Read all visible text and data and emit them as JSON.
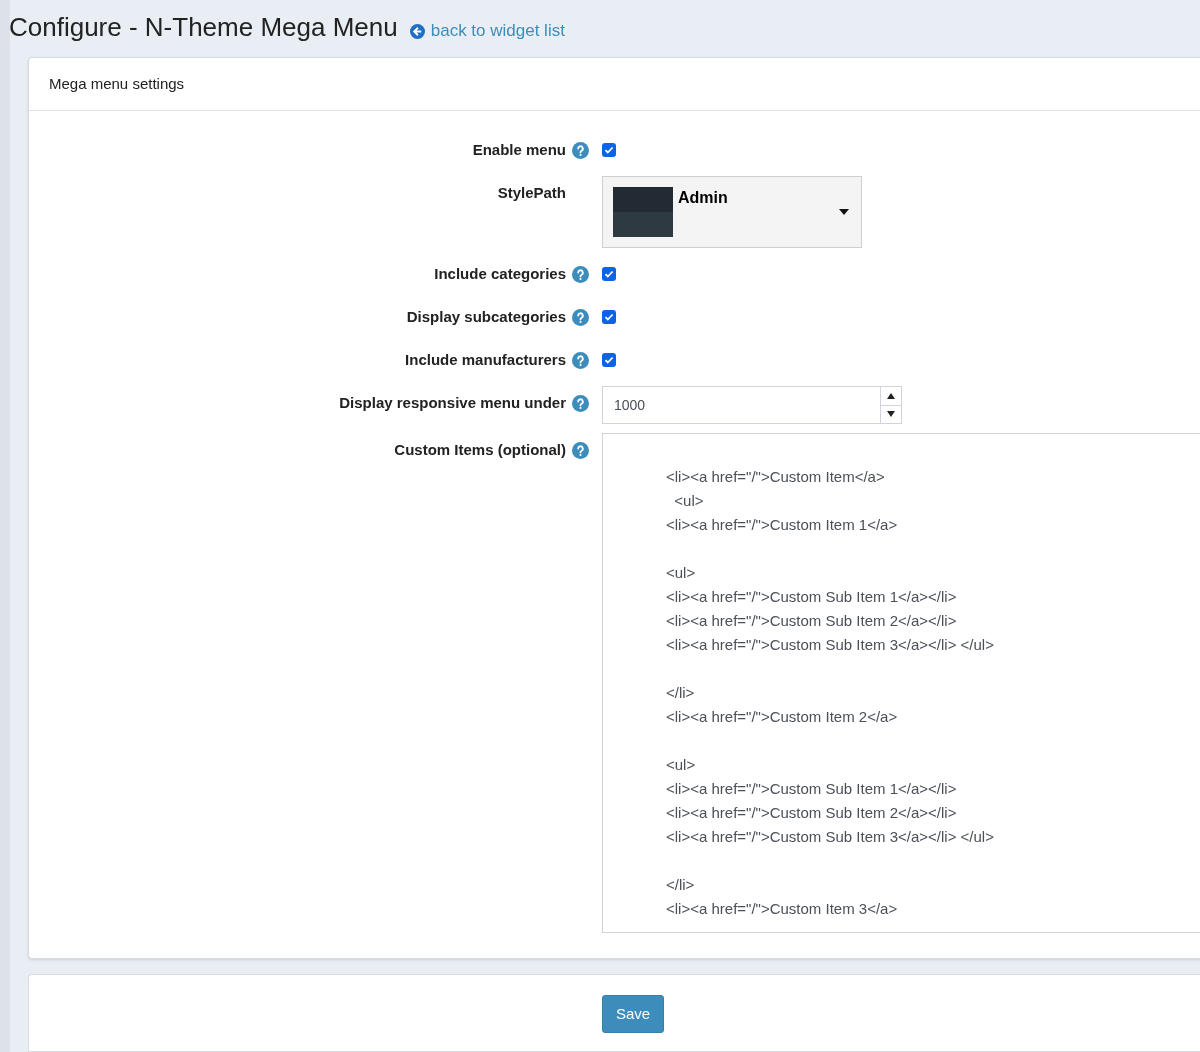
{
  "page": {
    "title": "Configure - N-Theme Mega Menu",
    "back_link": "back to widget list"
  },
  "card": {
    "title": "Mega menu settings"
  },
  "fields": [
    {
      "kind": "checkbox",
      "label": "Enable menu",
      "help": true,
      "checked": true
    },
    {
      "kind": "style-select",
      "label": "StylePath",
      "help": false,
      "value": "Admin"
    },
    {
      "kind": "checkbox",
      "label": "Include categories",
      "help": true,
      "checked": true
    },
    {
      "kind": "checkbox",
      "label": "Display subcategories",
      "help": true,
      "checked": true
    },
    {
      "kind": "checkbox",
      "label": "Include manufacturers",
      "help": true,
      "checked": true
    },
    {
      "kind": "number",
      "label": "Display responsive menu under",
      "help": true,
      "value": "1000"
    },
    {
      "kind": "textarea",
      "label": "Custom Items (optional)",
      "help": true,
      "value": "<li><a href=\"/\">Custom Item</a>\n  <ul>\n<li><a href=\"/\">Custom Item 1</a>\n\n<ul>\n<li><a href=\"/\">Custom Sub Item 1</a></li>\n<li><a href=\"/\">Custom Sub Item 2</a></li>\n<li><a href=\"/\">Custom Sub Item 3</a></li> </ul>\n\n</li>\n<li><a href=\"/\">Custom Item 2</a>\n\n<ul>\n<li><a href=\"/\">Custom Sub Item 1</a></li>\n<li><a href=\"/\">Custom Sub Item 2</a></li>\n<li><a href=\"/\">Custom Sub Item 3</a></li> </ul>\n\n</li>\n<li><a href=\"/\">Custom Item 3</a>"
    }
  ],
  "save_button": "Save"
}
